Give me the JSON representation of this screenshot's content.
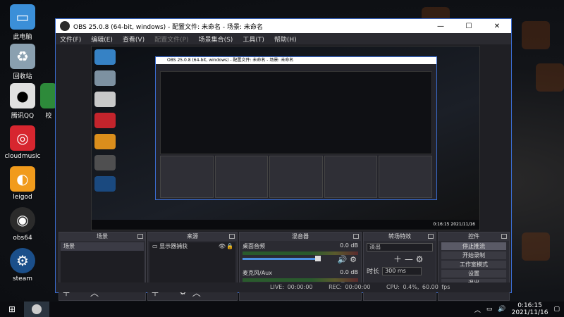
{
  "desktop": {
    "icons": [
      {
        "label": "此电脑",
        "icon": "computer-icon",
        "color": "#3b8fd8"
      },
      {
        "label": "回收站",
        "icon": "recycle-bin-icon",
        "color": "#8aa0b0"
      },
      {
        "label": "腾讯QQ",
        "icon": "qq-icon",
        "color": "#e0e0e0"
      },
      {
        "label": "cloudmusic",
        "icon": "cloudmusic-icon",
        "color": "#d7262f"
      },
      {
        "label": "leigod",
        "icon": "leigod-icon",
        "color": "#f19b1c"
      },
      {
        "label": "obs64",
        "icon": "obs-icon",
        "color": "#2b2b2b"
      },
      {
        "label": "steam",
        "icon": "steam-icon",
        "color": "#1b4f8a"
      }
    ],
    "partial_label": "校"
  },
  "window": {
    "title": "OBS 25.0.8 (64-bit, windows) - 配置文件: 未命名 - 场景: 未命名",
    "menu": [
      "文件(F)",
      "编辑(E)",
      "查看(V)",
      "配置文件(P)",
      "场景集合(S)",
      "工具(T)",
      "帮助(H)"
    ],
    "docks": {
      "scenes": {
        "title": "场景",
        "items": [
          "场景"
        ]
      },
      "sources": {
        "title": "来源",
        "items": [
          "显示器捕获"
        ]
      },
      "mixer": {
        "title": "混音器",
        "tracks": [
          {
            "name": "桌面音频",
            "db": "0.0 dB"
          },
          {
            "name": "麦克风/Aux",
            "db": "0.0 dB"
          }
        ]
      },
      "transitions": {
        "title": "转场特效",
        "transition": "淡出",
        "duration_label": "时长",
        "duration": "300 ms"
      },
      "controls": {
        "title": "控件",
        "buttons": [
          "停止推流",
          "开始录制",
          "工作室模式",
          "设置",
          "退出"
        ]
      }
    },
    "status": {
      "live": "LIVE: 00:00:00",
      "rec": "REC: 00:00:00",
      "cpu": "CPU: 0.4%, 60.00 fps"
    }
  },
  "taskbar": {
    "time": "0:16:15",
    "date": "2021/11/16",
    "mini_time": "0:16:15",
    "mini_date": "2021/11/16"
  }
}
